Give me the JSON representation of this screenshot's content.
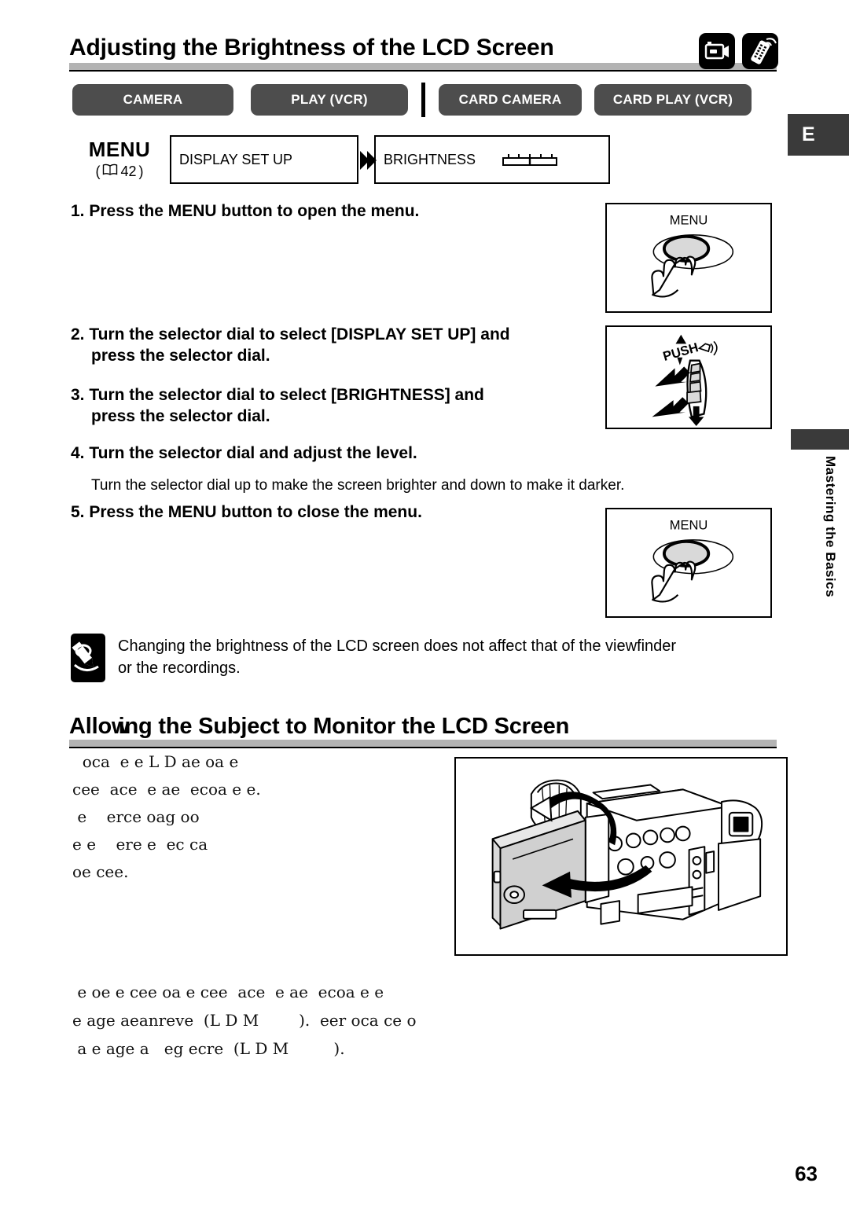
{
  "document": {
    "page_number": "63",
    "language_tab": "E",
    "side_tab": "Mastering the Basics"
  },
  "section_1": {
    "title": "Adjusting the Brightness of the LCD Screen",
    "header_icons": [
      {
        "name": "camcorder-icon",
        "label": "camcorder"
      },
      {
        "name": "wireless-remote-icon",
        "label": "wireless remote controller"
      }
    ],
    "mode_buttons": [
      {
        "label": "CAMERA"
      },
      {
        "label": "PLAY (VCR)"
      },
      {
        "label": "CARD CAMERA"
      },
      {
        "label": "CARD PLAY (VCR)"
      }
    ],
    "menu_path": {
      "label": "MENU",
      "reference_open": "(",
      "reference_page": "42",
      "reference_close": ")",
      "items": [
        {
          "label": "DISPLAY SET UP"
        },
        {
          "label": "BRIGHTNESS"
        }
      ]
    },
    "steps": [
      {
        "number": "1.",
        "line1": "Press the MENU button to open the menu.",
        "line2": ""
      },
      {
        "number": "2.",
        "line1": "Turn the selector dial to select [DISPLAY SET UP] and",
        "line2": "press the selector dial."
      },
      {
        "number": "3.",
        "line1": "Turn the selector dial to select [BRIGHTNESS] and",
        "line2": "press the selector dial."
      },
      {
        "number": "4.",
        "line1": "Turn the selector dial and adjust the level.",
        "line2": ""
      },
      {
        "number": "5.",
        "line1": "Press the MENU button to close the menu.",
        "line2": ""
      }
    ],
    "step4_note": "Turn the selector dial up to make the screen brighter and down to make it darker.",
    "illustrations": [
      {
        "name": "menu-button-press",
        "caption": "MENU"
      },
      {
        "name": "selector-dial-push",
        "caption": "PUSH"
      },
      {
        "name": "menu-button-press-2",
        "caption": "MENU"
      }
    ],
    "note": {
      "icon": "note-pencil-icon",
      "line1": "Changing the brightness of the LCD screen does not affect that of the viewfinder",
      "line2": "or the recordings."
    }
  },
  "section_2": {
    "title_part1": "Allo",
    "title_overlap": "w",
    "title_part2": "ing the Subject to Monitor the LCD Screen",
    "title_full": "Allowing the Subject to Monitor the LCD Screen",
    "body_top": "  oca  e e L D ae oa e\ncee  ace  e ae  ecoa e e.\n e    erce oag oo\ne e    ere e  ec ca\noe cee.",
    "body_bottom": " e oe e cee oa e cee  ace  e ae  ecoa e e\ne age aeanreve  (L D M        ).  eer oca ce o\n a e age a   eg ecre  (L D M         ).",
    "illustration": {
      "name": "camcorder-lcd-rotation",
      "label": "camcorder with rotating LCD panel"
    }
  }
}
